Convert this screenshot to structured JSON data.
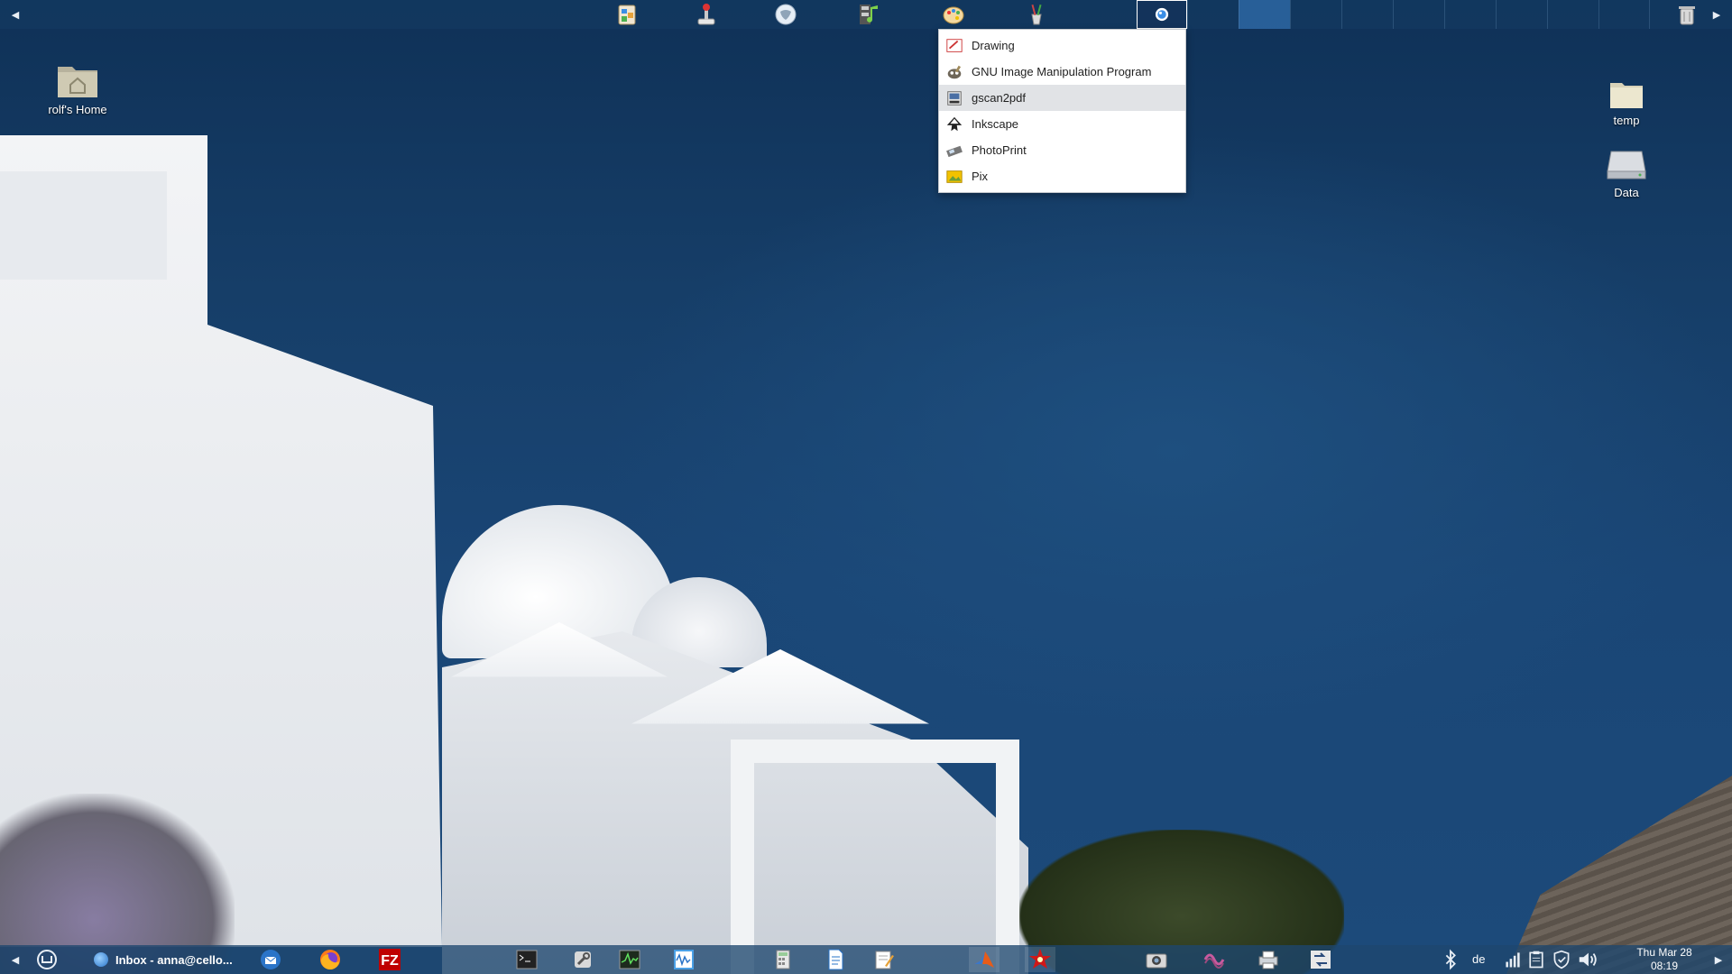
{
  "desktop": {
    "icons": [
      {
        "label": "rolf's Home",
        "icon": "home-folder-icon"
      },
      {
        "label": "temp",
        "icon": "folder-icon"
      },
      {
        "label": "Data",
        "icon": "drive-icon"
      }
    ]
  },
  "top_panel": {
    "launchers": [
      "office-apps-icon",
      "games-joystick-icon",
      "internet-globe-icon",
      "multimedia-icon",
      "graphics-palette-icon",
      "accessories-icon",
      "system-active-icon"
    ],
    "active_color": "#3c82c8"
  },
  "graphics_menu": {
    "items": [
      {
        "label": "Drawing",
        "icon": "drawing-icon"
      },
      {
        "label": "GNU Image Manipulation Program",
        "icon": "gimp-icon"
      },
      {
        "label": "gscan2pdf",
        "icon": "scanner-icon",
        "highlighted": true
      },
      {
        "label": "Inkscape",
        "icon": "inkscape-icon"
      },
      {
        "label": "PhotoPrint",
        "icon": "photoprint-icon"
      },
      {
        "label": "Pix",
        "icon": "pix-icon"
      }
    ]
  },
  "bottom_panel": {
    "task": {
      "label": "Inbox - anna@cello..."
    },
    "keyboard_layout": "de",
    "clock": {
      "day": "Thu Mar 28",
      "time": "08:19"
    }
  }
}
